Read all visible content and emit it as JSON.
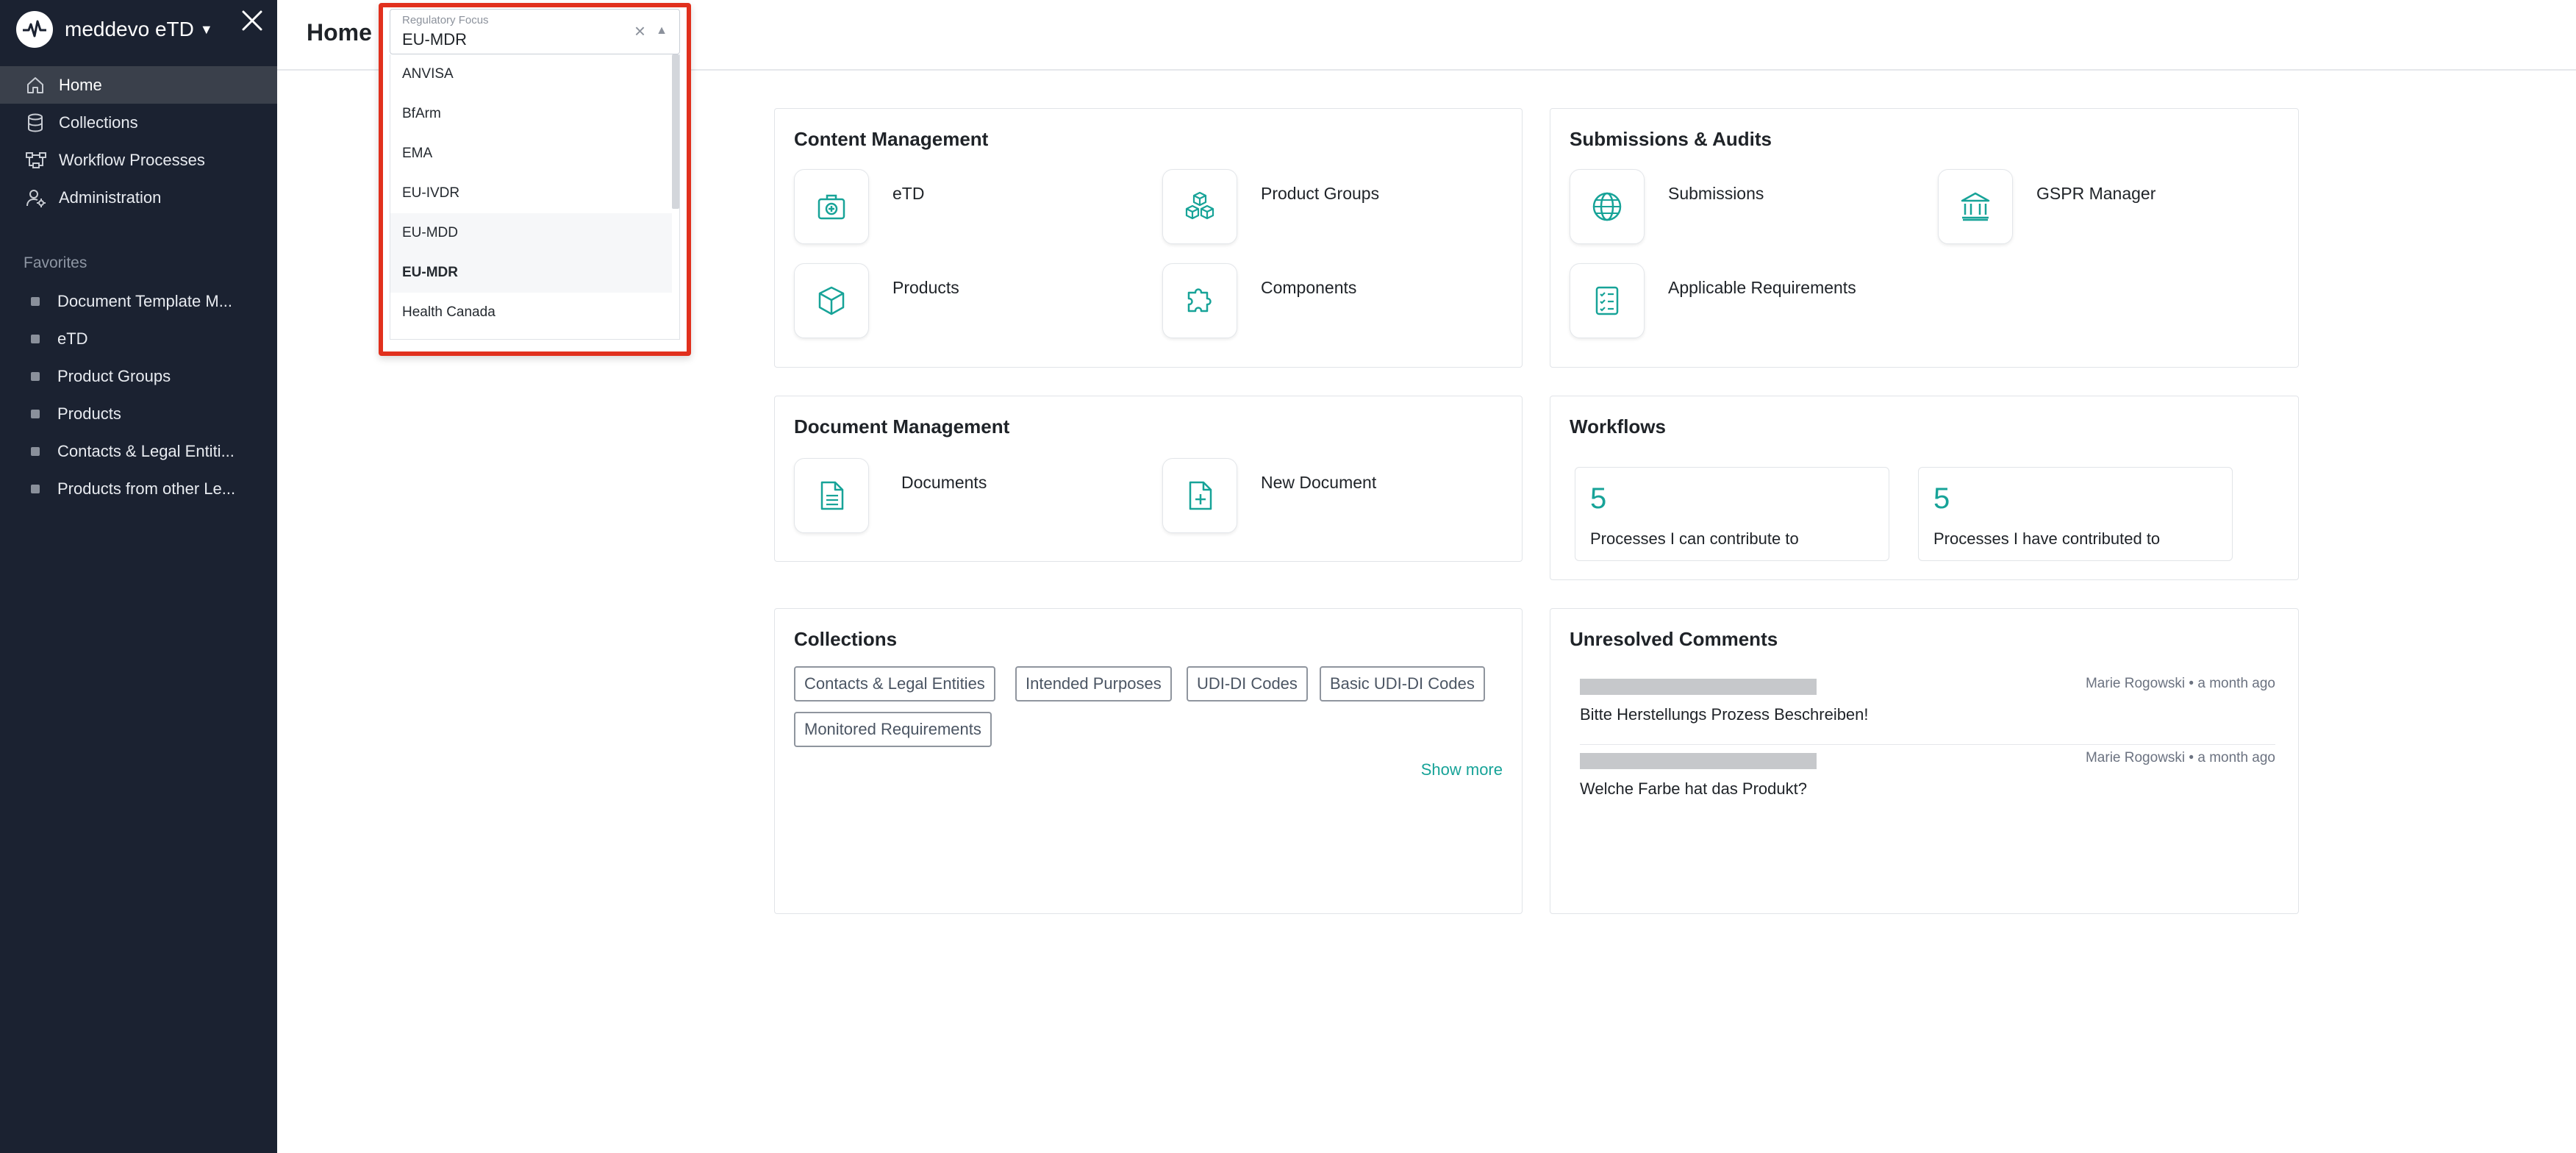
{
  "app": {
    "name": "meddevo eTD"
  },
  "sidebar": {
    "nav": [
      {
        "label": "Home",
        "icon": "home-icon",
        "active": true
      },
      {
        "label": "Collections",
        "icon": "database-icon",
        "active": false
      },
      {
        "label": "Workflow Processes",
        "icon": "workflow-icon",
        "active": false
      },
      {
        "label": "Administration",
        "icon": "user-gear-icon",
        "active": false
      }
    ],
    "favorites_title": "Favorites",
    "favorites": [
      "Document Template M...",
      "eTD",
      "Product Groups",
      "Products",
      "Contacts & Legal Entiti...",
      "Products from other Le..."
    ]
  },
  "header": {
    "title": "Home"
  },
  "regulatory_focus": {
    "label": "Regulatory Focus",
    "value": "EU-MDR",
    "options": [
      "ANVISA",
      "BfArm",
      "EMA",
      "EU-IVDR",
      "EU-MDD",
      "EU-MDR",
      "Health Canada"
    ],
    "hovered": "EU-MDD",
    "selected": "EU-MDR",
    "clear_symbol": "×",
    "caret_symbol": "▲"
  },
  "content_management": {
    "title": "Content Management",
    "tiles": [
      {
        "label": "eTD",
        "icon": "medical-kit-icon"
      },
      {
        "label": "Product Groups",
        "icon": "cubes-icon"
      },
      {
        "label": "Products",
        "icon": "cube-icon"
      },
      {
        "label": "Components",
        "icon": "puzzle-icon"
      }
    ]
  },
  "submissions_audits": {
    "title": "Submissions & Audits",
    "tiles": [
      {
        "label": "Submissions",
        "icon": "globe-icon"
      },
      {
        "label": "GSPR Manager",
        "icon": "bank-icon"
      },
      {
        "label": "Applicable Requirements",
        "icon": "checklist-icon"
      }
    ]
  },
  "document_management": {
    "title": "Document Management",
    "tiles": [
      {
        "label": "Documents",
        "icon": "document-icon"
      },
      {
        "label": "New Document",
        "icon": "document-add-icon"
      }
    ]
  },
  "workflows": {
    "title": "Workflows",
    "stats": [
      {
        "value": "5",
        "label": "Processes I can contribute to"
      },
      {
        "value": "5",
        "label": "Processes I have contributed to"
      }
    ]
  },
  "collections": {
    "title": "Collections",
    "chips": [
      "Contacts & Legal Entities",
      "Intended Purposes",
      "UDI-DI Codes",
      "Basic UDI-DI Codes",
      "Monitored Requirements"
    ],
    "show_more": "Show more"
  },
  "unresolved_comments": {
    "title": "Unresolved Comments",
    "items": [
      {
        "author": "Marie Rogowski",
        "time": "a month ago",
        "separator": "•",
        "text": "Bitte Herstellungs Prozess Beschreiben!"
      },
      {
        "author": "Marie Rogowski",
        "time": "a month ago",
        "separator": "•",
        "text": "Welche Farbe hat das Produkt?"
      }
    ]
  },
  "colors": {
    "accent": "#17a398",
    "sidebar_bg": "#1b2231",
    "highlight": "#e1301d"
  }
}
